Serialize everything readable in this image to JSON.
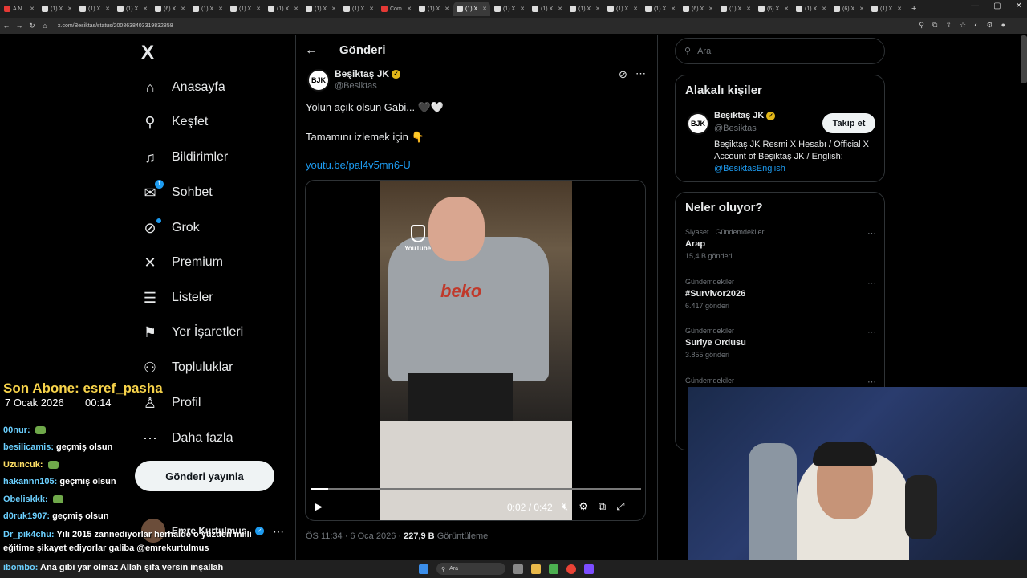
{
  "browser": {
    "tabs": [
      {
        "label": "A N",
        "fav": "red",
        "active": false
      },
      {
        "label": "(1) X",
        "fav": "x",
        "active": false
      },
      {
        "label": "(1) X",
        "fav": "x",
        "active": false
      },
      {
        "label": "(1) X",
        "fav": "x",
        "active": false
      },
      {
        "label": "(6) X",
        "fav": "x",
        "active": false
      },
      {
        "label": "(1) X",
        "fav": "x",
        "active": false
      },
      {
        "label": "(1) X",
        "fav": "x",
        "active": false
      },
      {
        "label": "(1) X",
        "fav": "x",
        "active": false
      },
      {
        "label": "(1) X",
        "fav": "x",
        "active": false
      },
      {
        "label": "(1) X",
        "fav": "x",
        "active": false
      },
      {
        "label": "Com",
        "fav": "red",
        "active": false
      },
      {
        "label": "(1) X",
        "fav": "x",
        "active": false
      },
      {
        "label": "(1) X",
        "fav": "x",
        "active": true
      },
      {
        "label": "(1) X",
        "fav": "x",
        "active": false
      },
      {
        "label": "(1) X",
        "fav": "x",
        "active": false
      },
      {
        "label": "(1) X",
        "fav": "x",
        "active": false
      },
      {
        "label": "(1) X",
        "fav": "x",
        "active": false
      },
      {
        "label": "(1) X",
        "fav": "x",
        "active": false
      },
      {
        "label": "(6) X",
        "fav": "x",
        "active": false
      },
      {
        "label": "(1) X",
        "fav": "x",
        "active": false
      },
      {
        "label": "(6) X",
        "fav": "x",
        "active": false
      },
      {
        "label": "(1) X",
        "fav": "x",
        "active": false
      },
      {
        "label": "(6) X",
        "fav": "x",
        "active": false
      },
      {
        "label": "(1) X",
        "fav": "x",
        "active": false
      }
    ],
    "url": "x.com/Besiktas/status/2008638403319832858"
  },
  "nav": {
    "logo": "X",
    "items": [
      {
        "label": "Anasayfa",
        "icon": "home-icon",
        "glyph": "⌂"
      },
      {
        "label": "Keşfet",
        "icon": "search-icon",
        "glyph": "⚲"
      },
      {
        "label": "Bildirimler",
        "icon": "bell-icon",
        "glyph": "♫"
      },
      {
        "label": "Sohbet",
        "icon": "mail-icon",
        "glyph": "✉"
      },
      {
        "label": "Grok",
        "icon": "grok-icon",
        "glyph": "⊘"
      },
      {
        "label": "Premium",
        "icon": "x-icon",
        "glyph": "✕"
      },
      {
        "label": "Listeler",
        "icon": "list-icon",
        "glyph": "☰"
      },
      {
        "label": "Yer İşaretleri",
        "icon": "bookmark-icon",
        "glyph": "⚑"
      },
      {
        "label": "Topluluklar",
        "icon": "people-icon",
        "glyph": "⚇"
      },
      {
        "label": "Profil",
        "icon": "person-icon",
        "glyph": "♙"
      },
      {
        "label": "Daha fazla",
        "icon": "more-circle-icon",
        "glyph": "⋯"
      }
    ],
    "sohbet_badge": "1",
    "post_button": "Gönderi yayınla",
    "account_name": "Emre Kurtulmuş"
  },
  "post": {
    "page_title": "Gönderi",
    "author_name": "Beşiktaş JK",
    "author_handle": "@Besiktas",
    "text_line1": "Yolun açık olsun Gabi... 🖤🤍",
    "text_line2": "Tamamını izlemek için 👇",
    "link": "youtu.be/pal4v5mn6-U",
    "video": {
      "current_time": "0:02",
      "duration": "0:42",
      "time_display": "0:02 / 0:42",
      "progress": 0.05,
      "frame_brand": "beko",
      "watermark": "YouTube"
    },
    "meta_time": "ÖS 11:34 · 6 Oca 2026 ·",
    "views": "227,9 B",
    "views_label": "Görüntüleme"
  },
  "sidebar": {
    "search_placeholder": "Ara",
    "related_title": "Alakalı kişiler",
    "related_name": "Beşiktaş JK",
    "related_handle": "@Besiktas",
    "follow_button": "Takip et",
    "related_bio": "Beşiktaş JK Resmi X Hesabı / Official X Account of Beşiktaş JK / English:",
    "related_bio_mention": "@BesiktasEnglish",
    "trends_title": "Neler oluyor?",
    "trends": [
      {
        "category": "Siyaset · Gündemdekiler",
        "name": "Arap",
        "count": "15,4 B gönderi"
      },
      {
        "category": "Gündemdekiler",
        "name": "#Survivor2026",
        "count": "6.417 gönderi"
      },
      {
        "category": "Gündemdekiler",
        "name": "Suriye Ordusu",
        "count": "3.855 gönderi"
      },
      {
        "category": "Gündemdekiler",
        "name": "",
        "count": ""
      }
    ]
  },
  "stream": {
    "last_sub": "Son Abone: esref_pasha",
    "date": "7 Ocak 2026",
    "time": "00:14",
    "chat": [
      {
        "user": "00nur:",
        "msg": "",
        "emote": true
      },
      {
        "user": "besilicamis:",
        "msg": "geçmiş olsun",
        "emote": false
      },
      {
        "user": "Uzuncuk:",
        "msg": "",
        "emote": true
      },
      {
        "user": "hakannn105:",
        "msg": "geçmiş olsun",
        "emote": false
      },
      {
        "user": "Obeliskkk:",
        "msg": "",
        "emote": true
      },
      {
        "user": "d0ruk1907:",
        "msg": "geçmiş olsun",
        "emote": false
      },
      {
        "user": "Dr_pik4chu:",
        "msg": "Yılı 2015 zannediyorlar herhalde o yüzden milli",
        "emote": false
      }
    ],
    "chat_continuation": "eğitime şikayet ediyorlar galiba @emrekurtulmus",
    "taskbar_chat_user": "ibombo:",
    "taskbar_chat_msg": "Ana gibi yar olmaz Allah şifa versin inşallah",
    "taskbar_search": "Ara"
  },
  "colors": {
    "accent": "#1d9bf0",
    "verified": "#e2b719",
    "background": "#000000",
    "sub_highlight": "#f7d34a"
  }
}
